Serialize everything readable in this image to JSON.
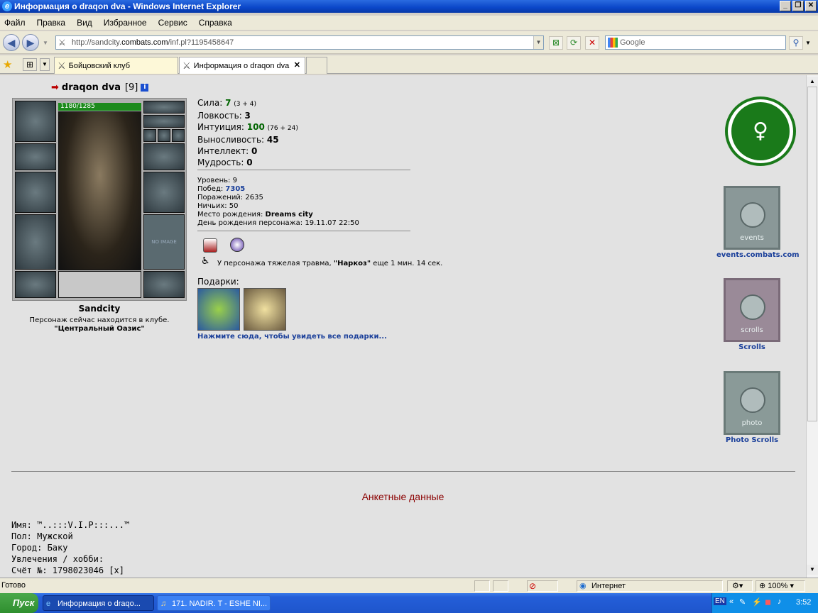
{
  "window": {
    "title": "Информация о draqon dva - Windows Internet Explorer",
    "min": "_",
    "max": "❐",
    "close": "✕"
  },
  "menu": [
    "Файл",
    "Правка",
    "Вид",
    "Избранное",
    "Сервис",
    "Справка"
  ],
  "address": {
    "prefix": "http://sandcity.",
    "host": "combats.com",
    "path": "/inf.pl?1195458647"
  },
  "search": {
    "placeholder": "Google"
  },
  "tabs": [
    {
      "label": "Бойцовский клуб"
    },
    {
      "label": "Информация о draqon dva"
    }
  ],
  "tab_close": "✕",
  "character": {
    "name": "draqon dva",
    "level": "[9]",
    "info_icon": "i",
    "hp": "1180/1285",
    "city": "Sandcity",
    "club_text": "Персонаж сейчас находится в клубе.",
    "club_location": "\"Центральный Оазис\"",
    "no_image": "NO IMAGE"
  },
  "stats": [
    {
      "label": "Сила: ",
      "value": "7",
      "extra": "(3 + 4)",
      "green": true
    },
    {
      "label": "Ловкость: ",
      "value": "3",
      "extra": "",
      "green": false
    },
    {
      "label": "Интуиция: ",
      "value": "100",
      "extra": "(76 + 24)",
      "green": true
    },
    {
      "label": "Выносливость: ",
      "value": "45",
      "extra": "",
      "green": false
    },
    {
      "label": "Интеллект: ",
      "value": "0",
      "extra": "",
      "green": false
    },
    {
      "label": "Мудрость: ",
      "value": "0",
      "extra": "",
      "green": false
    }
  ],
  "info": {
    "level_label": "Уровень: ",
    "level": "9",
    "wins_label": "Побед: ",
    "wins": "7305",
    "losses_label": "Поражений: ",
    "losses": "2635",
    "draws_label": "Ничьих: ",
    "draws": "50",
    "birthplace_label": "Место рождения: ",
    "birthplace": "Dreams city",
    "birthday_label": "День рождения персонажа: ",
    "birthday": "19.11.07 22:50"
  },
  "trauma": {
    "prefix": "У персонажа тяжелая травма, ",
    "name": "\"Наркоз\"",
    "suffix": " еще 1 мин. 14 сек."
  },
  "gifts": {
    "title": "Подарки:",
    "link": "Нажмите сюда, чтобы увидеть все подарки..."
  },
  "banners": [
    {
      "caption": "events",
      "label": "events.combats.com"
    },
    {
      "caption": "scrolls",
      "label": "Scrolls"
    },
    {
      "caption": "photo",
      "label": "Photo Scrolls"
    }
  ],
  "profile": {
    "title": "Анкетные данные",
    "lines": [
      "Имя: ™..:::V.I.P:::...™",
      "Пол: Мужской",
      "Город: Баку",
      "Увлечения / хобби:",
      "Счёт №: 1798023046 [x]"
    ]
  },
  "statusbar": {
    "status": "Готово",
    "zone": "Интернет",
    "zoom": "100%"
  },
  "taskbar": {
    "start": "Пуск",
    "items": [
      "Информация о draqo...",
      "171. NADIR. T - ESHE NI..."
    ],
    "lang": "EN",
    "time": "3:52"
  },
  "colors": {
    "win_title": "#0a46c8",
    "section_title": "#8b0000",
    "link": "#1a3f9a",
    "stat_green": "#006400"
  }
}
